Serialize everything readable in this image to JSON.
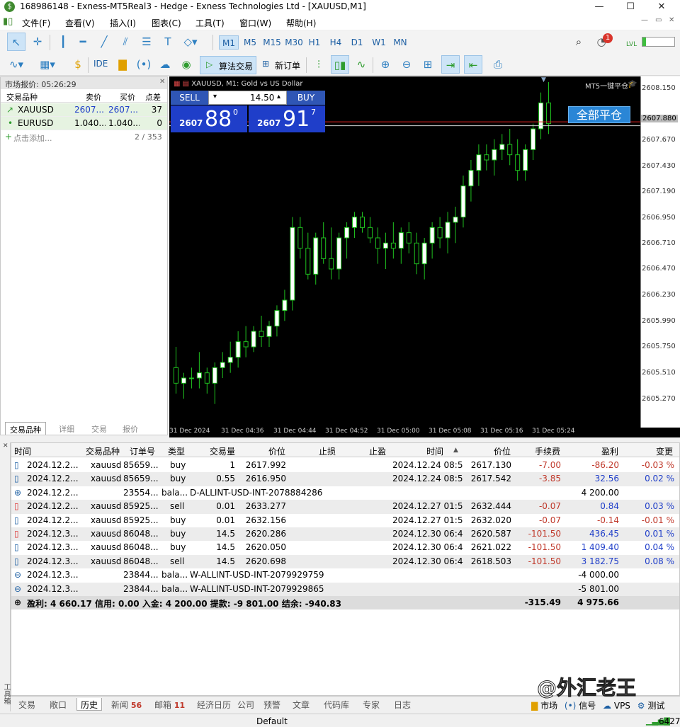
{
  "window": {
    "title": "168986148 - Exness-MT5Real3 - Hedge - Exness Technologies Ltd - [XAUUSD,M1]",
    "min": "—",
    "max": "☐",
    "close": "✕"
  },
  "menu": [
    "文件(F)",
    "查看(V)",
    "插入(I)",
    "图表(C)",
    "工具(T)",
    "窗口(W)",
    "帮助(H)"
  ],
  "toolbar": {
    "timeframes": [
      "M1",
      "M5",
      "M15",
      "M30",
      "H1",
      "H4",
      "D1",
      "W1",
      "MN"
    ],
    "active_timeframe": "M1",
    "ide": "IDE",
    "algo": "算法交易",
    "new_order": "新订单",
    "notif_count": "1",
    "lvl": "LVL"
  },
  "market_watch": {
    "title": "市场报价: 05:26:29",
    "cols": [
      "交易品种",
      "卖价",
      "买价",
      "点差"
    ],
    "rows": [
      {
        "sym": "XAUUSD",
        "bid": "2607....",
        "ask": "2607....",
        "spread": "37",
        "arrow": "↗"
      },
      {
        "sym": "EURUSD",
        "bid": "1.040....",
        "ask": "1.040....",
        "spread": "0",
        "arrow": "•"
      }
    ],
    "add": "点击添加...",
    "count": "2 / 353",
    "tabs": [
      "交易品种",
      "详细",
      "交易",
      "报价"
    ]
  },
  "chart": {
    "info": "XAUUSD, M1:  Gold vs US Dollar",
    "one_click": "MT5一键平仓",
    "sell_label": "SELL",
    "buy_label": "BUY",
    "volume": "14.50",
    "sell_small": "2607",
    "sell_big": "88",
    "sell_sup": "0",
    "buy_small": "2607",
    "buy_big": "91",
    "buy_sup": "7",
    "close_all": "全部平仓",
    "price_labels": [
      "2608.150",
      "2607.880",
      "2607.670",
      "2607.430",
      "2607.190",
      "2606.950",
      "2606.710",
      "2606.470",
      "2606.230",
      "2605.990",
      "2605.750",
      "2605.510",
      "2605.270"
    ],
    "time_labels": [
      "31 Dec 2024",
      "31 Dec 04:36",
      "31 Dec 04:44",
      "31 Dec 04:52",
      "31 Dec 05:00",
      "31 Dec 05:08",
      "31 Dec 05:16",
      "31 Dec 05:24"
    ],
    "current_price_label": "2607.880",
    "bid_line_color": "#d8d8d8",
    "ask_line_color": "#e02020",
    "bull_color": "#ffffff",
    "bear_color": "#000000",
    "wick_color": "#1fc21f"
  },
  "chart_data": {
    "type": "candlestick",
    "ylim": [
      2605.15,
      2608.3
    ],
    "x_ticks": [
      "31 Dec 2024",
      "31 Dec 04:36",
      "31 Dec 04:44",
      "31 Dec 04:52",
      "31 Dec 05:00",
      "31 Dec 05:08",
      "31 Dec 05:16",
      "31 Dec 05:24"
    ],
    "candles": [
      [
        2605.55,
        2605.75,
        2605.3,
        2605.4
      ],
      [
        2605.4,
        2605.5,
        2605.25,
        2605.45
      ],
      [
        2605.45,
        2605.55,
        2605.35,
        2605.45
      ],
      [
        2605.45,
        2605.7,
        2605.35,
        2605.5
      ],
      [
        2605.5,
        2605.55,
        2605.3,
        2605.4
      ],
      [
        2605.4,
        2605.6,
        2605.2,
        2605.55
      ],
      [
        2605.55,
        2605.7,
        2605.45,
        2605.6
      ],
      [
        2605.6,
        2605.8,
        2605.5,
        2605.65
      ],
      [
        2605.65,
        2605.9,
        2605.55,
        2605.8
      ],
      [
        2605.8,
        2605.95,
        2605.65,
        2605.75
      ],
      [
        2605.75,
        2605.95,
        2605.7,
        2605.9
      ],
      [
        2605.9,
        2606.05,
        2605.75,
        2605.85
      ],
      [
        2605.85,
        2606.0,
        2605.75,
        2605.95
      ],
      [
        2605.95,
        2606.15,
        2605.85,
        2606.1
      ],
      [
        2606.1,
        2606.3,
        2606.0,
        2606.2
      ],
      [
        2606.2,
        2607.0,
        2606.1,
        2606.9
      ],
      [
        2606.9,
        2607.0,
        2606.6,
        2606.7
      ],
      [
        2606.7,
        2606.85,
        2606.4,
        2606.45
      ],
      [
        2606.45,
        2606.85,
        2606.35,
        2606.8
      ],
      [
        2606.8,
        2606.95,
        2606.55,
        2606.6
      ],
      [
        2606.6,
        2606.9,
        2606.4,
        2606.5
      ],
      [
        2606.5,
        2606.85,
        2606.4,
        2606.8
      ],
      [
        2606.8,
        2606.95,
        2606.6,
        2606.9
      ],
      [
        2606.9,
        2607.05,
        2606.8,
        2607.0
      ],
      [
        2607.0,
        2607.05,
        2606.85,
        2606.9
      ],
      [
        2606.9,
        2607.0,
        2606.75,
        2606.8
      ],
      [
        2606.8,
        2606.9,
        2606.55,
        2606.7
      ],
      [
        2606.7,
        2606.85,
        2606.5,
        2606.75
      ],
      [
        2606.75,
        2606.95,
        2606.6,
        2606.7
      ],
      [
        2606.7,
        2606.9,
        2606.55,
        2606.85
      ],
      [
        2606.85,
        2606.95,
        2606.65,
        2606.75
      ],
      [
        2606.75,
        2606.85,
        2606.45,
        2606.55
      ],
      [
        2606.55,
        2606.8,
        2606.4,
        2606.75
      ],
      [
        2606.75,
        2606.95,
        2606.6,
        2606.9
      ],
      [
        2606.9,
        2607.0,
        2606.7,
        2606.8
      ],
      [
        2606.8,
        2607.05,
        2606.65,
        2606.95
      ],
      [
        2606.95,
        2607.1,
        2606.75,
        2607.0
      ],
      [
        2607.0,
        2607.4,
        2606.9,
        2607.3
      ],
      [
        2607.3,
        2607.55,
        2607.15,
        2607.45
      ],
      [
        2607.45,
        2607.7,
        2607.3,
        2607.6
      ],
      [
        2607.6,
        2607.7,
        2607.45,
        2607.55
      ],
      [
        2607.55,
        2607.75,
        2607.4,
        2607.65
      ],
      [
        2607.65,
        2607.8,
        2607.55,
        2607.7
      ],
      [
        2607.7,
        2607.85,
        2607.5,
        2607.6
      ],
      [
        2607.6,
        2607.75,
        2607.35,
        2607.45
      ],
      [
        2607.45,
        2607.7,
        2607.35,
        2607.65
      ],
      [
        2607.65,
        2607.9,
        2607.55,
        2607.85
      ],
      [
        2607.85,
        2608.2,
        2607.75,
        2608.1
      ],
      [
        2608.1,
        2608.3,
        2607.8,
        2607.9
      ]
    ],
    "current_bid": 2607.88,
    "current_ask": 2607.917
  },
  "history": {
    "cols": [
      "时间",
      "交易品种",
      "订单号",
      "类型",
      "交易量",
      "价位",
      "止损",
      "止盈",
      "时间",
      "价位",
      "手续费",
      "盈利",
      "变更"
    ],
    "rows": [
      {
        "icon": "doc",
        "t1": "2024.12.2...",
        "sym": "xauusd",
        "id": "85659...",
        "type": "buy",
        "vol": "1",
        "p1": "2617.992",
        "t2": "2024.12.24 08:5...",
        "p2": "2617.130",
        "fee": "-7.00",
        "pl": "-86.20",
        "chg": "-0.03 %",
        "pl_neg": true,
        "chg_neg": true
      },
      {
        "icon": "doc",
        "t1": "2024.12.2...",
        "sym": "xauusd",
        "id": "85659...",
        "type": "buy",
        "vol": "0.55",
        "p1": "2616.950",
        "t2": "2024.12.24 08:5...",
        "p2": "2617.542",
        "fee": "-3.85",
        "pl": "32.56",
        "chg": "0.02 %",
        "pl_neg": false,
        "chg_neg": false
      },
      {
        "icon": "plus",
        "t1": "2024.12.2...",
        "sym": "",
        "id": "23554...",
        "type": "bala...",
        "comment": "D-ALLINT-USD-INT-2078884286",
        "pl": "4 200.00",
        "balance": true
      },
      {
        "icon": "doc-red",
        "t1": "2024.12.2...",
        "sym": "xauusd",
        "id": "85925...",
        "type": "sell",
        "vol": "0.01",
        "p1": "2633.277",
        "t2": "2024.12.27 01:5...",
        "p2": "2632.444",
        "fee": "-0.07",
        "pl": "0.84",
        "chg": "0.03 %",
        "pl_neg": false,
        "chg_neg": false
      },
      {
        "icon": "doc",
        "t1": "2024.12.2...",
        "sym": "xauusd",
        "id": "85925...",
        "type": "buy",
        "vol": "0.01",
        "p1": "2632.156",
        "t2": "2024.12.27 01:5...",
        "p2": "2632.020",
        "fee": "-0.07",
        "pl": "-0.14",
        "chg": "-0.01 %",
        "pl_neg": true,
        "chg_neg": true
      },
      {
        "icon": "doc-red",
        "t1": "2024.12.3...",
        "sym": "xauusd",
        "id": "86048...",
        "type": "buy",
        "vol": "14.5",
        "p1": "2620.286",
        "t2": "2024.12.30 06:4...",
        "p2": "2620.587",
        "fee": "-101.50",
        "pl": "436.45",
        "chg": "0.01 %",
        "pl_neg": false,
        "chg_neg": false
      },
      {
        "icon": "doc",
        "t1": "2024.12.3...",
        "sym": "xauusd",
        "id": "86048...",
        "type": "buy",
        "vol": "14.5",
        "p1": "2620.050",
        "t2": "2024.12.30 06:4...",
        "p2": "2621.022",
        "fee": "-101.50",
        "pl": "1 409.40",
        "chg": "0.04 %",
        "pl_neg": false,
        "chg_neg": false
      },
      {
        "icon": "doc",
        "t1": "2024.12.3...",
        "sym": "xauusd",
        "id": "86048...",
        "type": "sell",
        "vol": "14.5",
        "p1": "2620.698",
        "t2": "2024.12.30 06:4...",
        "p2": "2618.503",
        "fee": "-101.50",
        "pl": "3 182.75",
        "chg": "0.08 %",
        "pl_neg": false,
        "chg_neg": false
      },
      {
        "icon": "minus",
        "t1": "2024.12.3...",
        "sym": "",
        "id": "23844...",
        "type": "bala...",
        "comment": "W-ALLINT-USD-INT-2079929759",
        "pl": "-4 000.00",
        "balance": true
      },
      {
        "icon": "minus",
        "t1": "2024.12.3...",
        "sym": "",
        "id": "23844...",
        "type": "bala...",
        "comment": "W-ALLINT-USD-INT-2079929865",
        "pl": "-5 801.00",
        "balance": true
      }
    ],
    "total": {
      "text": "盈利: 4 660.17  信用: 0.00  入金: 4 200.00  提款: -9 801.00  结余: -940.83",
      "fee": "-315.49",
      "pl": "4 975.66"
    }
  },
  "side_label": "工具箱",
  "bottom_tabs": [
    {
      "label": "交易",
      "badge": ""
    },
    {
      "label": "敞口",
      "badge": ""
    },
    {
      "label": "历史",
      "badge": "",
      "active": true
    },
    {
      "label": "新闻",
      "badge": "56"
    },
    {
      "label": "邮箱",
      "badge": "11"
    },
    {
      "label": "经济日历",
      "badge": ""
    },
    {
      "label": "公司",
      "badge": ""
    },
    {
      "label": "预警",
      "badge": ""
    },
    {
      "label": "文章",
      "badge": ""
    },
    {
      "label": "代码库",
      "badge": ""
    },
    {
      "label": "专家",
      "badge": ""
    },
    {
      "label": "日志",
      "badge": ""
    }
  ],
  "bottom_right": [
    "市场",
    "信号",
    "VPS",
    "测试"
  ],
  "watermark": "@外汇老王",
  "status": {
    "profile": "Default",
    "value": "6427"
  }
}
